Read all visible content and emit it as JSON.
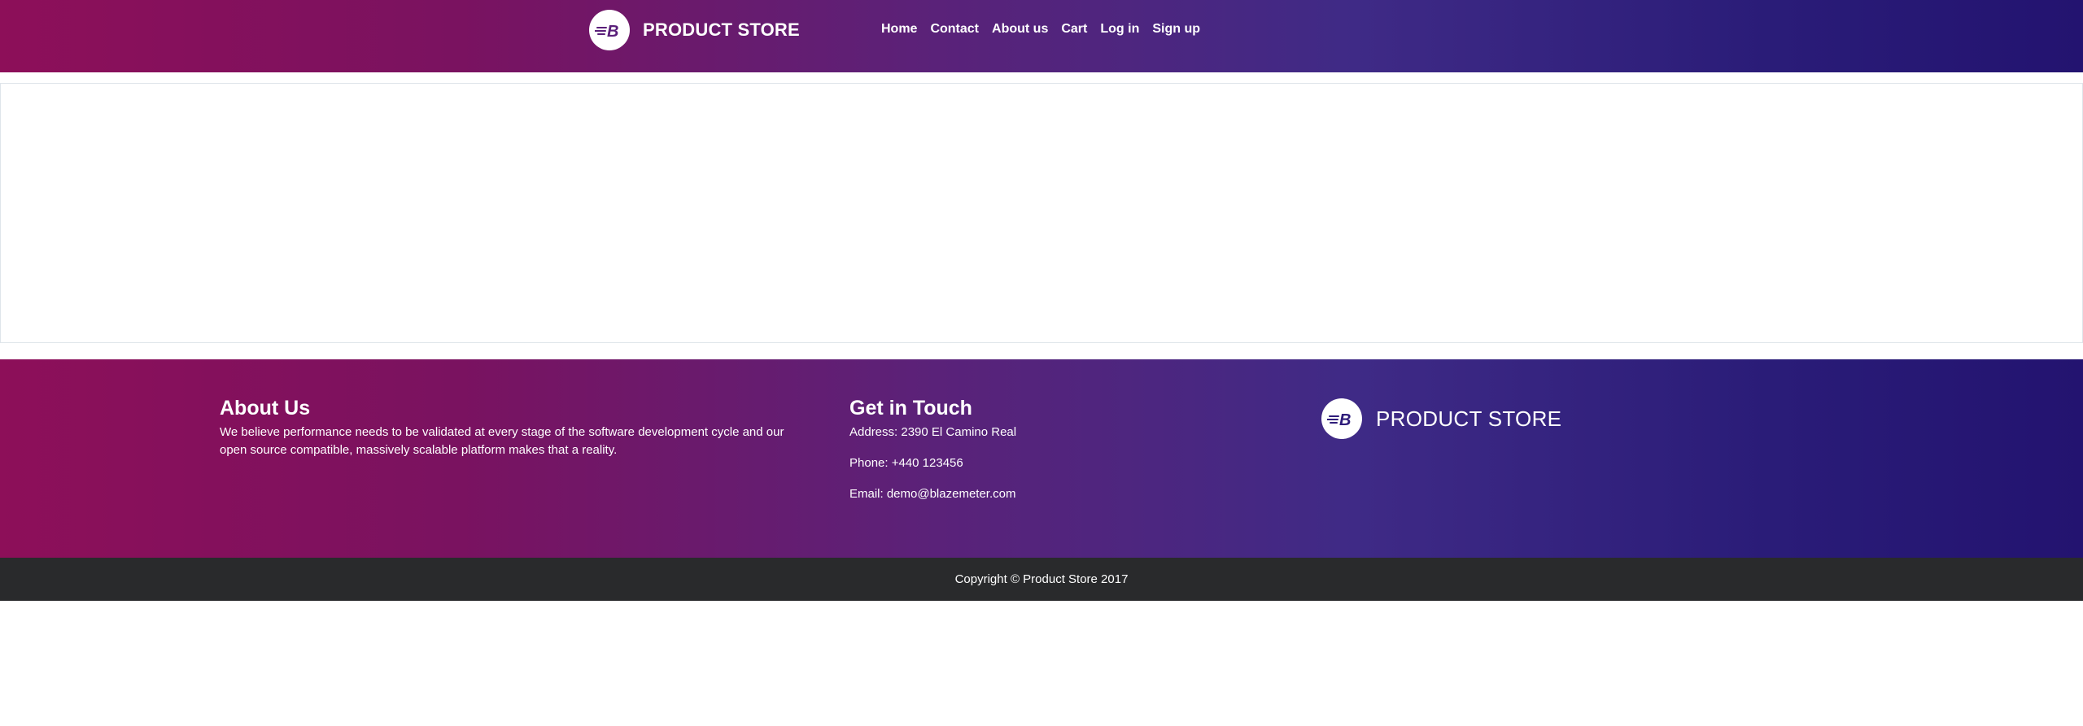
{
  "colors": {
    "gradient_start": "#8d0f59",
    "gradient_end": "#231370",
    "copyright_bg": "#292a2c",
    "logo_letter": "#5a1f7a"
  },
  "navbar": {
    "brand_text": "PRODUCT STORE",
    "logo_icon": "blazemeter-b-logo",
    "links": [
      {
        "label": "Home"
      },
      {
        "label": "Contact"
      },
      {
        "label": "About us"
      },
      {
        "label": "Cart"
      },
      {
        "label": "Log in"
      },
      {
        "label": "Sign up"
      }
    ]
  },
  "footer": {
    "about": {
      "title": "About Us",
      "text": "We believe performance needs to be validated at every stage of the software development cycle and our open source compatible, massively scalable platform makes that a reality."
    },
    "touch": {
      "title": "Get in Touch",
      "address": "Address: 2390 El Camino Real",
      "phone": "Phone: +440 123456",
      "email": "Email: demo@blazemeter.com"
    },
    "brand_text": "PRODUCT STORE",
    "logo_icon": "blazemeter-b-logo"
  },
  "copyright": "Copyright © Product Store 2017"
}
